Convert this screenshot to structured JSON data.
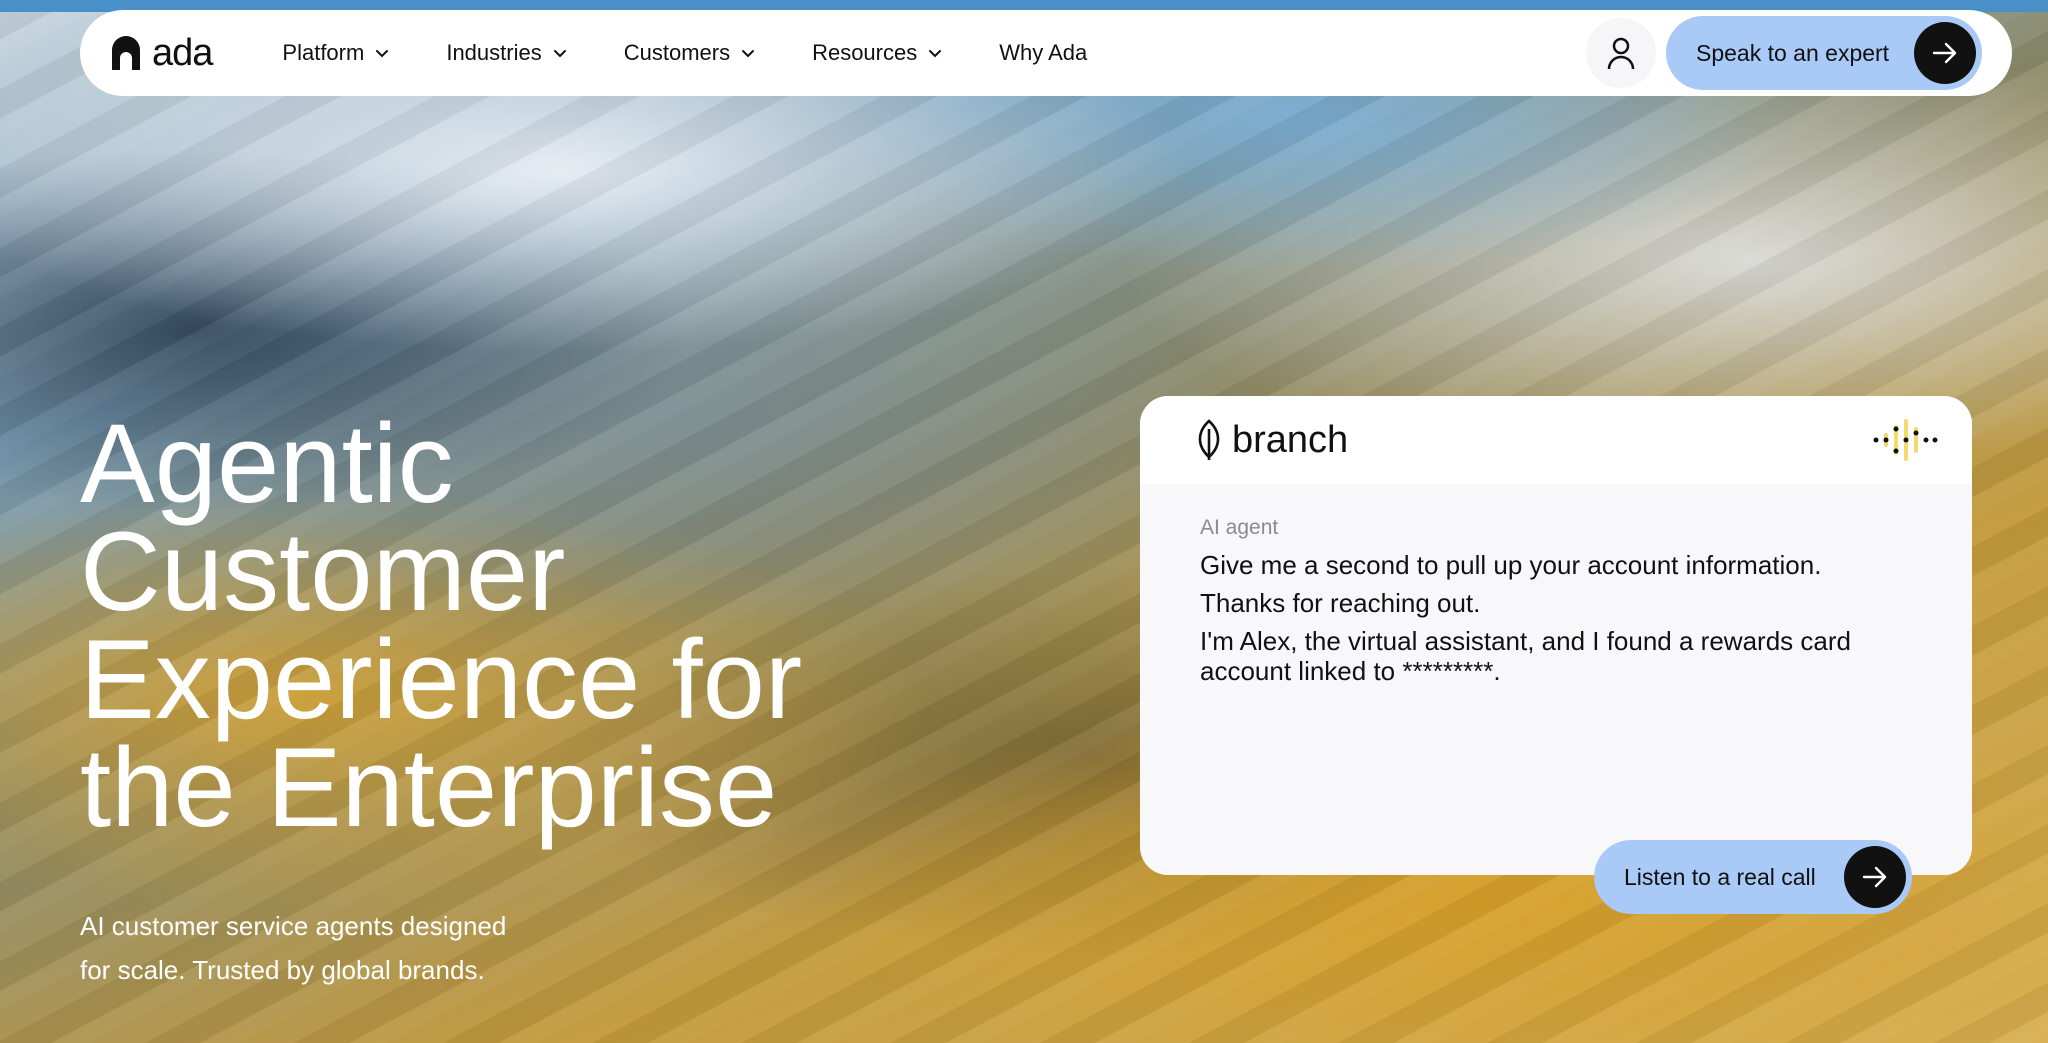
{
  "nav": {
    "logo_text": "ada",
    "links": [
      {
        "label": "Platform",
        "has_dropdown": true
      },
      {
        "label": "Industries",
        "has_dropdown": true
      },
      {
        "label": "Customers",
        "has_dropdown": true
      },
      {
        "label": "Resources",
        "has_dropdown": true
      },
      {
        "label": "Why Ada",
        "has_dropdown": false
      }
    ],
    "account_icon": "user-icon",
    "cta_label": "Speak to an expert"
  },
  "hero": {
    "title_lines": [
      "Agentic",
      "Customer",
      "Experience for",
      "the Enterprise"
    ],
    "subtitle_lines": [
      "AI customer service agents designed",
      "for scale. Trusted by global brands."
    ]
  },
  "card": {
    "brand_name": "branch",
    "voice_icon": "voice-waveform-icon",
    "agent_label": "AI agent",
    "messages": [
      "Give me a second to pull up your account information.",
      "Thanks for reaching out.",
      "I'm Alex, the virtual assistant, and I found a rewards card account linked to *********."
    ],
    "listen_label": "Listen to a real call"
  },
  "colors": {
    "cta_bg": "#a9c9f7",
    "arrow_bg": "#111111",
    "nav_bg": "#ffffff",
    "card_bg": "#f8f7fa",
    "voice_accent": "#f5d96b"
  }
}
